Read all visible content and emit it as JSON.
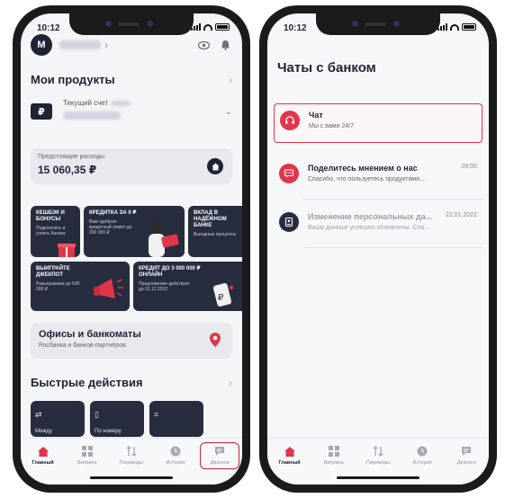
{
  "status": {
    "time": "10:12"
  },
  "left": {
    "profile": {
      "avatar": "M"
    },
    "products": {
      "title": "Мои продукты",
      "account_label": "Текущий счет",
      "currency": "₽"
    },
    "expense": {
      "label": "Предстоящие расходы",
      "amount": "15 060,35 ₽"
    },
    "banners": [
      {
        "title": "Кешбэк и бонусы",
        "sub": "Подключить и узнать баланс"
      },
      {
        "title": "Кредитка за 0 ₽",
        "sub": "Вам одобрен кредитный лимит до 200 000 ₽"
      },
      {
        "title": "Вклад в надёжном банке",
        "sub": "Выгодные проценты"
      },
      {
        "title": "Выиграйте джекпот",
        "sub": "Разыгрываем до 500 000 ₽"
      },
      {
        "title": "Кредит до 3 000 000 ₽ онлайн",
        "sub": "Предложение действует до 01.12.2022"
      }
    ],
    "offices": {
      "title": "Офисы и банкоматы",
      "sub": "Росбанка и банков-партнёров"
    },
    "quick_actions": {
      "title": "Быстрые действия",
      "items": [
        {
          "label": "Между"
        },
        {
          "label": "По номеру"
        },
        {
          "label": ""
        }
      ]
    }
  },
  "right": {
    "title": "Чаты с банком",
    "chats": [
      {
        "title": "Чат",
        "sub": "Мы с вами 24/7",
        "date": ""
      },
      {
        "title": "Поделитесь мнением о нас",
        "sub": "Спасибо, что пользуетесь продуктами...",
        "date": "09:00"
      },
      {
        "title": "Изменение персональных да...",
        "sub": "Ваши данные успешно обновлены. Спа...",
        "date": "22.01.2022"
      }
    ]
  },
  "tabs": [
    {
      "label": "Главный",
      "icon": "home-icon"
    },
    {
      "label": "Витрина",
      "icon": "grid-icon"
    },
    {
      "label": "Переводы",
      "icon": "transfer-icon"
    },
    {
      "label": "История",
      "icon": "clock-icon"
    },
    {
      "label": "Диалоги",
      "icon": "chat-icon"
    }
  ],
  "colors": {
    "accent": "#E0364A",
    "dark": "#272D3F"
  }
}
